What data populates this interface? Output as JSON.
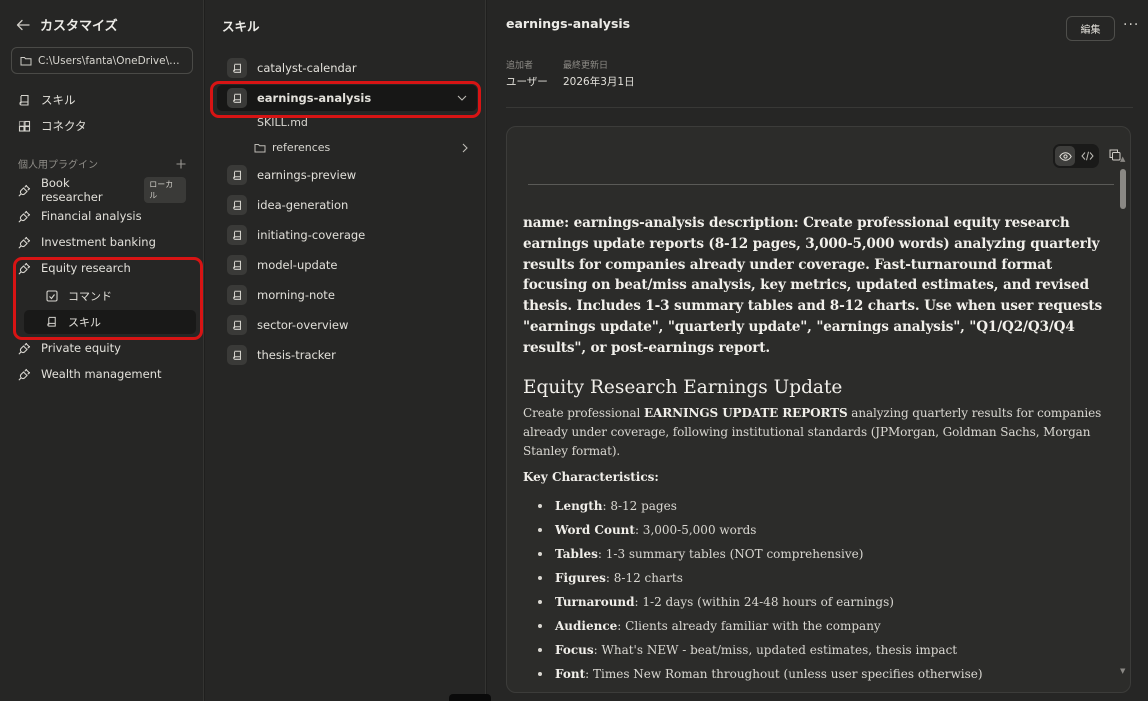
{
  "sidebar": {
    "title": "カスタマイズ",
    "path": "C:\\Users\\fanta\\OneDrive\\★価フ...",
    "nav": [
      {
        "label": "スキル",
        "icon": "skill-icon"
      },
      {
        "label": "コネクタ",
        "icon": "connector-icon"
      }
    ],
    "section_title": "個人用プラグイン",
    "plugins": [
      {
        "label": "Book researcher",
        "badge": "ローカル"
      },
      {
        "label": "Financial analysis"
      },
      {
        "label": "Investment banking"
      },
      {
        "label": "Equity research"
      },
      {
        "label": "Private equity"
      },
      {
        "label": "Wealth management"
      }
    ],
    "equity_sub": [
      {
        "label": "コマンド"
      },
      {
        "label": "スキル"
      }
    ]
  },
  "skills_panel": {
    "title": "スキル",
    "items": [
      "catalyst-calendar",
      "earnings-analysis",
      "earnings-preview",
      "idea-generation",
      "initiating-coverage",
      "model-update",
      "morning-note",
      "sector-overview",
      "thesis-tracker"
    ],
    "files": {
      "skill_md": "SKILL.md",
      "references": "references"
    }
  },
  "detail": {
    "title": "earnings-analysis",
    "edit_label": "編集",
    "more_label": "···",
    "added_by_label": "追加者",
    "added_by_value": "ユーザー",
    "updated_label": "最終更新日",
    "updated_value": "2026年3月1日"
  },
  "document": {
    "frontmatter": "name: earnings-analysis description: Create professional equity research earnings update reports (8-12 pages, 3,000-5,000 words) analyzing quarterly results for companies already under coverage. Fast-turnaround format focusing on beat/miss analysis, key metrics, updated estimates, and revised thesis. Includes 1-3 summary tables and 8-12 charts. Use when user requests \"earnings update\", \"quarterly update\", \"earnings analysis\", \"Q1/Q2/Q3/Q4 results\", or post-earnings report.",
    "heading": "Equity Research Earnings Update",
    "intro_before": "Create professional ",
    "intro_bold": "EARNINGS UPDATE REPORTS",
    "intro_after": " analyzing quarterly results for companies already under coverage, following institutional standards (JPMorgan, Goldman Sachs, Morgan Stanley format).",
    "key_heading": "Key Characteristics:",
    "characteristics": [
      {
        "term": "Length",
        "value": ": 8-12 pages"
      },
      {
        "term": "Word Count",
        "value": ": 3,000-5,000 words"
      },
      {
        "term": "Tables",
        "value": ": 1-3 summary tables (NOT comprehensive)"
      },
      {
        "term": "Figures",
        "value": ": 8-12 charts"
      },
      {
        "term": "Turnaround",
        "value": ": 1-2 days (within 24-48 hours of earnings)"
      },
      {
        "term": "Audience",
        "value": ": Clients already familiar with the company"
      },
      {
        "term": "Focus",
        "value": ": What's NEW - beat/miss, updated estimates, thesis impact"
      },
      {
        "term": "Font",
        "value": ": Times New Roman throughout (unless user specifies otherwise)"
      }
    ]
  },
  "colors": {
    "background": "#262625",
    "content_bg": "#2c2c2a",
    "highlight_border": "#d71414",
    "text": "#e6e4df"
  }
}
